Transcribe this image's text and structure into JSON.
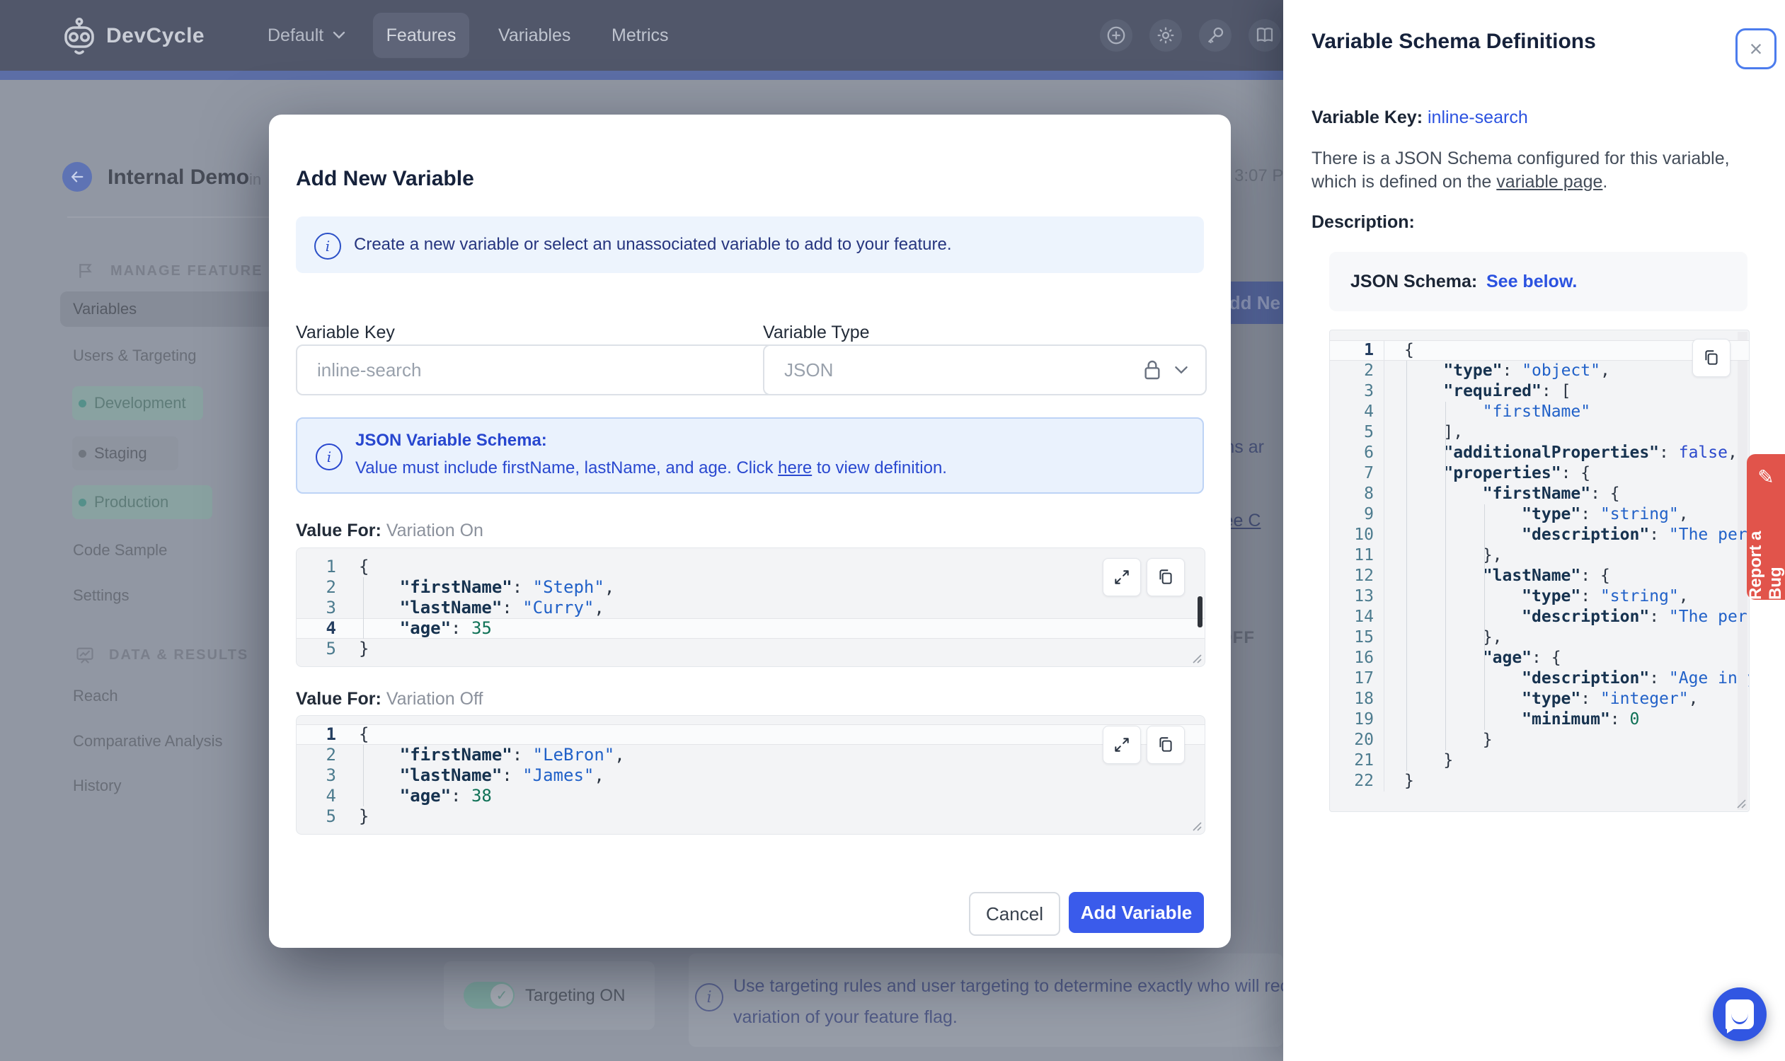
{
  "colors": {
    "accent_blue": "#3a5beb",
    "link_blue": "#2b52e0",
    "banner_bg": "#edf4fd",
    "bug_red": "#e1544b",
    "env_dot_teal": "#55908a",
    "env_dot_gray": "#70767f",
    "code_key": "#16324f",
    "code_string": "#2161c8",
    "code_number": "#0f7156",
    "code_keyword": "#2b49cc"
  },
  "navbar": {
    "brand": "DevCycle",
    "project_selector": "Default",
    "nav_features": "Features",
    "nav_variables": "Variables",
    "nav_metrics": "Metrics"
  },
  "sidebar": {
    "feature_title": "Internal Demo",
    "feature_key_fragment": "in",
    "section1_label": "MANAGE FEATURE",
    "items": {
      "variables": "Variables",
      "users_targeting": "Users & Targeting",
      "development": "Development",
      "staging": "Staging",
      "production": "Production",
      "code_sample": "Code Sample",
      "settings": "Settings"
    },
    "section2_label": "DATA & RESULTS",
    "items2": {
      "reach": "Reach",
      "comparative_analysis": "Comparative Analysis",
      "history": "History"
    }
  },
  "background": {
    "time_fragment": "3:07 P",
    "add_button_fragment": "Add Ne",
    "fragment_variations": "tions ar",
    "fragment_see_prefix": ". ",
    "fragment_see_link": "See C",
    "fragment_off": "OFF",
    "targeting_toggle_label": "Targeting ON",
    "targeting_info_line1": "Use targeting rules and user targeting to determine exactly who will receiv",
    "targeting_info_line2": "variation of your feature flag."
  },
  "modal": {
    "title": "Add New Variable",
    "info_banner": "Create a new variable or select an unassociated variable to add to your feature.",
    "variable_key_label": "Variable Key",
    "variable_key_value": "inline-search",
    "variable_type_label": "Variable Type",
    "variable_type_value": "JSON",
    "schema_banner_title": "JSON Variable Schema:",
    "schema_banner_text_before": "Value must include firstName, lastName, and age. Click ",
    "schema_banner_link": "here",
    "schema_banner_text_after": " to view definition.",
    "value_for_label": "Value For:",
    "variation_on_name": "Variation On",
    "variation_off_name": "Variation Off",
    "cancel_label": "Cancel",
    "submit_label": "Add Variable",
    "variation_on_code": {
      "active_line": 4,
      "lines": [
        [
          [
            "p",
            "{"
          ]
        ],
        [
          [
            "k",
            "    \"firstName\""
          ],
          [
            "p",
            ": "
          ],
          [
            "s",
            "\"Steph\""
          ],
          [
            "p",
            ","
          ]
        ],
        [
          [
            "k",
            "    \"lastName\""
          ],
          [
            "p",
            ": "
          ],
          [
            "s",
            "\"Curry\""
          ],
          [
            "p",
            ","
          ]
        ],
        [
          [
            "k",
            "    \"age\""
          ],
          [
            "p",
            ": "
          ],
          [
            "n",
            "35"
          ]
        ],
        [
          [
            "p",
            "}"
          ]
        ]
      ]
    },
    "variation_off_code": {
      "active_line": 1,
      "lines": [
        [
          [
            "p",
            "{"
          ]
        ],
        [
          [
            "k",
            "    \"firstName\""
          ],
          [
            "p",
            ": "
          ],
          [
            "s",
            "\"LeBron\""
          ],
          [
            "p",
            ","
          ]
        ],
        [
          [
            "k",
            "    \"lastName\""
          ],
          [
            "p",
            ": "
          ],
          [
            "s",
            "\"James\""
          ],
          [
            "p",
            ","
          ]
        ],
        [
          [
            "k",
            "    \"age\""
          ],
          [
            "p",
            ": "
          ],
          [
            "n",
            "38"
          ]
        ],
        [
          [
            "p",
            "}"
          ]
        ]
      ]
    }
  },
  "panel": {
    "title": "Variable Schema Definitions",
    "variable_key_label": "Variable Key: ",
    "variable_key_value": "inline-search",
    "intro_line1": "There is a JSON Schema configured for this variable,",
    "intro_line2_before": "which is defined on the ",
    "intro_link": "variable page",
    "intro_after": ".",
    "description_label": "Description:",
    "schema_label": "JSON Schema:",
    "schema_link": "See below.",
    "schema_code": {
      "active_line": 1,
      "lines": [
        [
          [
            "p",
            "{"
          ]
        ],
        [
          [
            "k",
            "    \"type\""
          ],
          [
            "p",
            ": "
          ],
          [
            "s",
            "\"object\""
          ],
          [
            "p",
            ","
          ]
        ],
        [
          [
            "k",
            "    \"required\""
          ],
          [
            "p",
            ": ["
          ]
        ],
        [
          [
            "s",
            "        \"firstName\""
          ]
        ],
        [
          [
            "p",
            "    ],"
          ]
        ],
        [
          [
            "k",
            "    \"additionalProperties\""
          ],
          [
            "p",
            ": "
          ],
          [
            "w",
            "false"
          ],
          [
            "p",
            ","
          ]
        ],
        [
          [
            "k",
            "    \"properties\""
          ],
          [
            "p",
            ": {"
          ]
        ],
        [
          [
            "k",
            "        \"firstName\""
          ],
          [
            "p",
            ": {"
          ]
        ],
        [
          [
            "k",
            "            \"type\""
          ],
          [
            "p",
            ": "
          ],
          [
            "s",
            "\"string\""
          ],
          [
            "p",
            ","
          ]
        ],
        [
          [
            "k",
            "            \"description\""
          ],
          [
            "p",
            ": "
          ],
          [
            "s",
            "\"The person's fi"
          ]
        ],
        [
          [
            "p",
            "        },"
          ]
        ],
        [
          [
            "k",
            "        \"lastName\""
          ],
          [
            "p",
            ": {"
          ]
        ],
        [
          [
            "k",
            "            \"type\""
          ],
          [
            "p",
            ": "
          ],
          [
            "s",
            "\"string\""
          ],
          [
            "p",
            ","
          ]
        ],
        [
          [
            "k",
            "            \"description\""
          ],
          [
            "p",
            ": "
          ],
          [
            "s",
            "\"The person's la"
          ]
        ],
        [
          [
            "p",
            "        },"
          ]
        ],
        [
          [
            "k",
            "        \"age\""
          ],
          [
            "p",
            ": {"
          ]
        ],
        [
          [
            "k",
            "            \"description\""
          ],
          [
            "p",
            ": "
          ],
          [
            "s",
            "\"Age in years wh"
          ]
        ],
        [
          [
            "k",
            "            \"type\""
          ],
          [
            "p",
            ": "
          ],
          [
            "s",
            "\"integer\""
          ],
          [
            "p",
            ","
          ]
        ],
        [
          [
            "k",
            "            \"minimum\""
          ],
          [
            "p",
            ": "
          ],
          [
            "n",
            "0"
          ]
        ],
        [
          [
            "p",
            "        }"
          ]
        ],
        [
          [
            "p",
            "    }"
          ]
        ],
        [
          [
            "p",
            "}"
          ]
        ]
      ]
    }
  },
  "widgets": {
    "report_bug_label": "Report a Bug"
  }
}
